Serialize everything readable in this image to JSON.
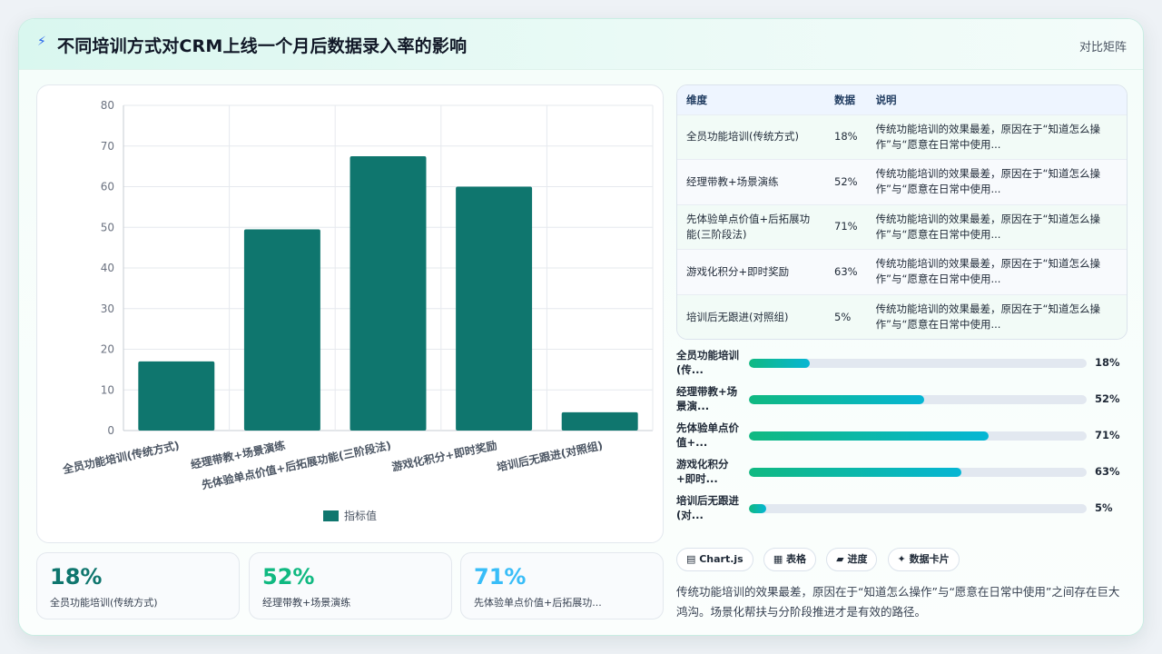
{
  "header": {
    "icon": "bolt-icon",
    "title": "不同培训方式对CRM上线一个月后数据录入率的影响",
    "right_label": "对比矩阵"
  },
  "chart_data": {
    "type": "bar",
    "categories": [
      "全员功能培训(传统方式)",
      "经理带教+场景演练",
      "先体验单点价值+后拓展功能(三阶段法)",
      "游戏化积分+即时奖励",
      "培训后无跟进(对照组)"
    ],
    "series": [
      {
        "name": "指标值",
        "values": [
          17,
          49.5,
          67.5,
          60,
          4.5
        ],
        "color": "#0f766e"
      }
    ],
    "ylim": [
      0,
      80
    ],
    "yticks": [
      0,
      10,
      20,
      30,
      40,
      50,
      60,
      70,
      80
    ],
    "grid": true,
    "legend": "bottom"
  },
  "stats": [
    {
      "value": "18%",
      "label": "全员功能培训(传统方式)",
      "color": "#0f766e"
    },
    {
      "value": "52%",
      "label": "经理带教+场景演练",
      "color": "#10b981"
    },
    {
      "value": "71%",
      "label": "先体验单点价值+后拓展功...",
      "color": "#38bdf8"
    }
  ],
  "table": {
    "headers": [
      "维度",
      "数据",
      "说明"
    ],
    "rows": [
      {
        "dim": "全员功能培训(传统方式)",
        "val": "18%",
        "desc": "传统功能培训的效果最差，原因在于“知道怎么操作”与“愿意在日常中使用..."
      },
      {
        "dim": "经理带教+场景演练",
        "val": "52%",
        "desc": "传统功能培训的效果最差，原因在于“知道怎么操作”与“愿意在日常中使用..."
      },
      {
        "dim": "先体验单点价值+后拓展功能(三阶段法)",
        "val": "71%",
        "desc": "传统功能培训的效果最差，原因在于“知道怎么操作”与“愿意在日常中使用..."
      },
      {
        "dim": "游戏化积分+即时奖励",
        "val": "63%",
        "desc": "传统功能培训的效果最差，原因在于“知道怎么操作”与“愿意在日常中使用..."
      },
      {
        "dim": "培训后无跟进(对照组)",
        "val": "5%",
        "desc": "传统功能培训的效果最差，原因在于“知道怎么操作”与“愿意在日常中使用..."
      }
    ]
  },
  "progress": [
    {
      "label": "全员功能培训(传...",
      "value": "18%",
      "fraction": 0.18
    },
    {
      "label": "经理带教+场景演...",
      "value": "52%",
      "fraction": 0.52
    },
    {
      "label": "先体验单点价值+...",
      "value": "71%",
      "fraction": 0.71
    },
    {
      "label": "游戏化积分+即时...",
      "value": "63%",
      "fraction": 0.63
    },
    {
      "label": "培训后无跟进(对...",
      "value": "5%",
      "fraction": 0.05
    }
  ],
  "tags": [
    "▤ Chart.js",
    "▦ 表格",
    "▰ 进度",
    "✦ 数据卡片"
  ],
  "summary": "传统功能培训的效果最差，原因在于“知道怎么操作”与“愿意在日常中使用”之间存在巨大鸿沟。场景化帮扶与分阶段推进才是有效的路径。"
}
